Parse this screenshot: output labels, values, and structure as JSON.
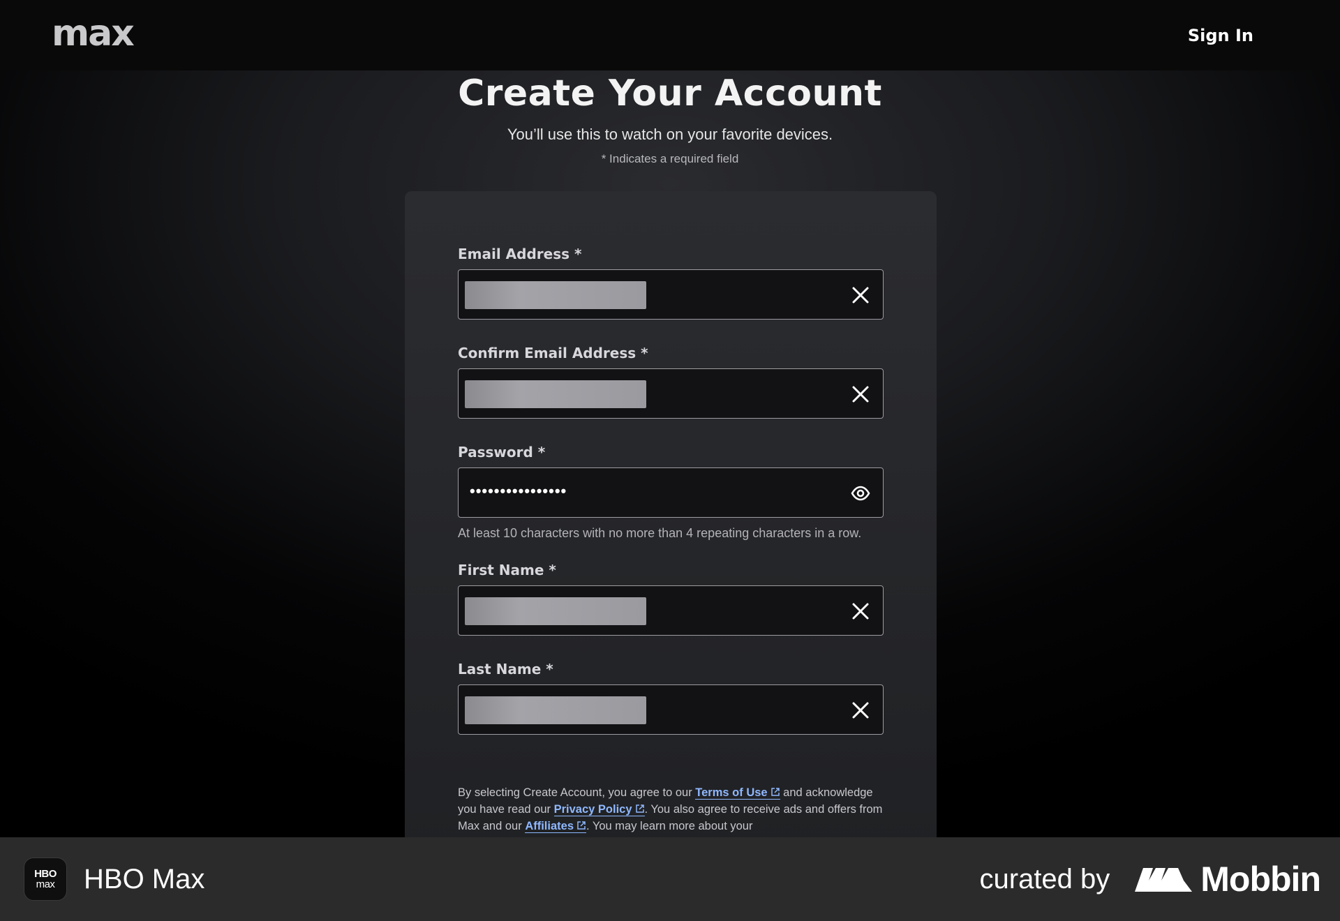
{
  "topbar": {
    "logo": "max",
    "sign_in": "Sign In"
  },
  "header": {
    "title": "Create Your Account",
    "subtitle": "You’ll use this to watch on your favorite devices.",
    "required_note": "* Indicates a required field"
  },
  "form": {
    "email": {
      "label": "Email Address *"
    },
    "confirm_email": {
      "label": "Confirm Email Address *"
    },
    "password": {
      "label": "Password *",
      "masked_value": "••••••••••••••••",
      "hint": "At least 10 characters with no more than 4 repeating characters in a row."
    },
    "first_name": {
      "label": "First Name *"
    },
    "last_name": {
      "label": "Last Name *"
    }
  },
  "legal": {
    "part1": "By selecting Create Account, you agree to our ",
    "terms": "Terms of Use",
    "part2": " and acknowledge you have read our ",
    "privacy": "Privacy Policy",
    "part3": ". You also agree to receive ads and offers from Max and our ",
    "affiliates": "Affiliates",
    "part4": ". You may learn more about your"
  },
  "footer": {
    "app_icon_top": "HBO",
    "app_icon_bottom": "max",
    "app_name": "HBO Max",
    "curated_by": "curated by",
    "brand": "Mobbin"
  },
  "colors": {
    "link": "#8fb8ff",
    "input_border": "#9c9ca2",
    "footer_bg": "#2b2b2b"
  },
  "icons": [
    "close-icon",
    "eye-icon",
    "external-link-icon",
    "mobbin-logo-icon"
  ]
}
